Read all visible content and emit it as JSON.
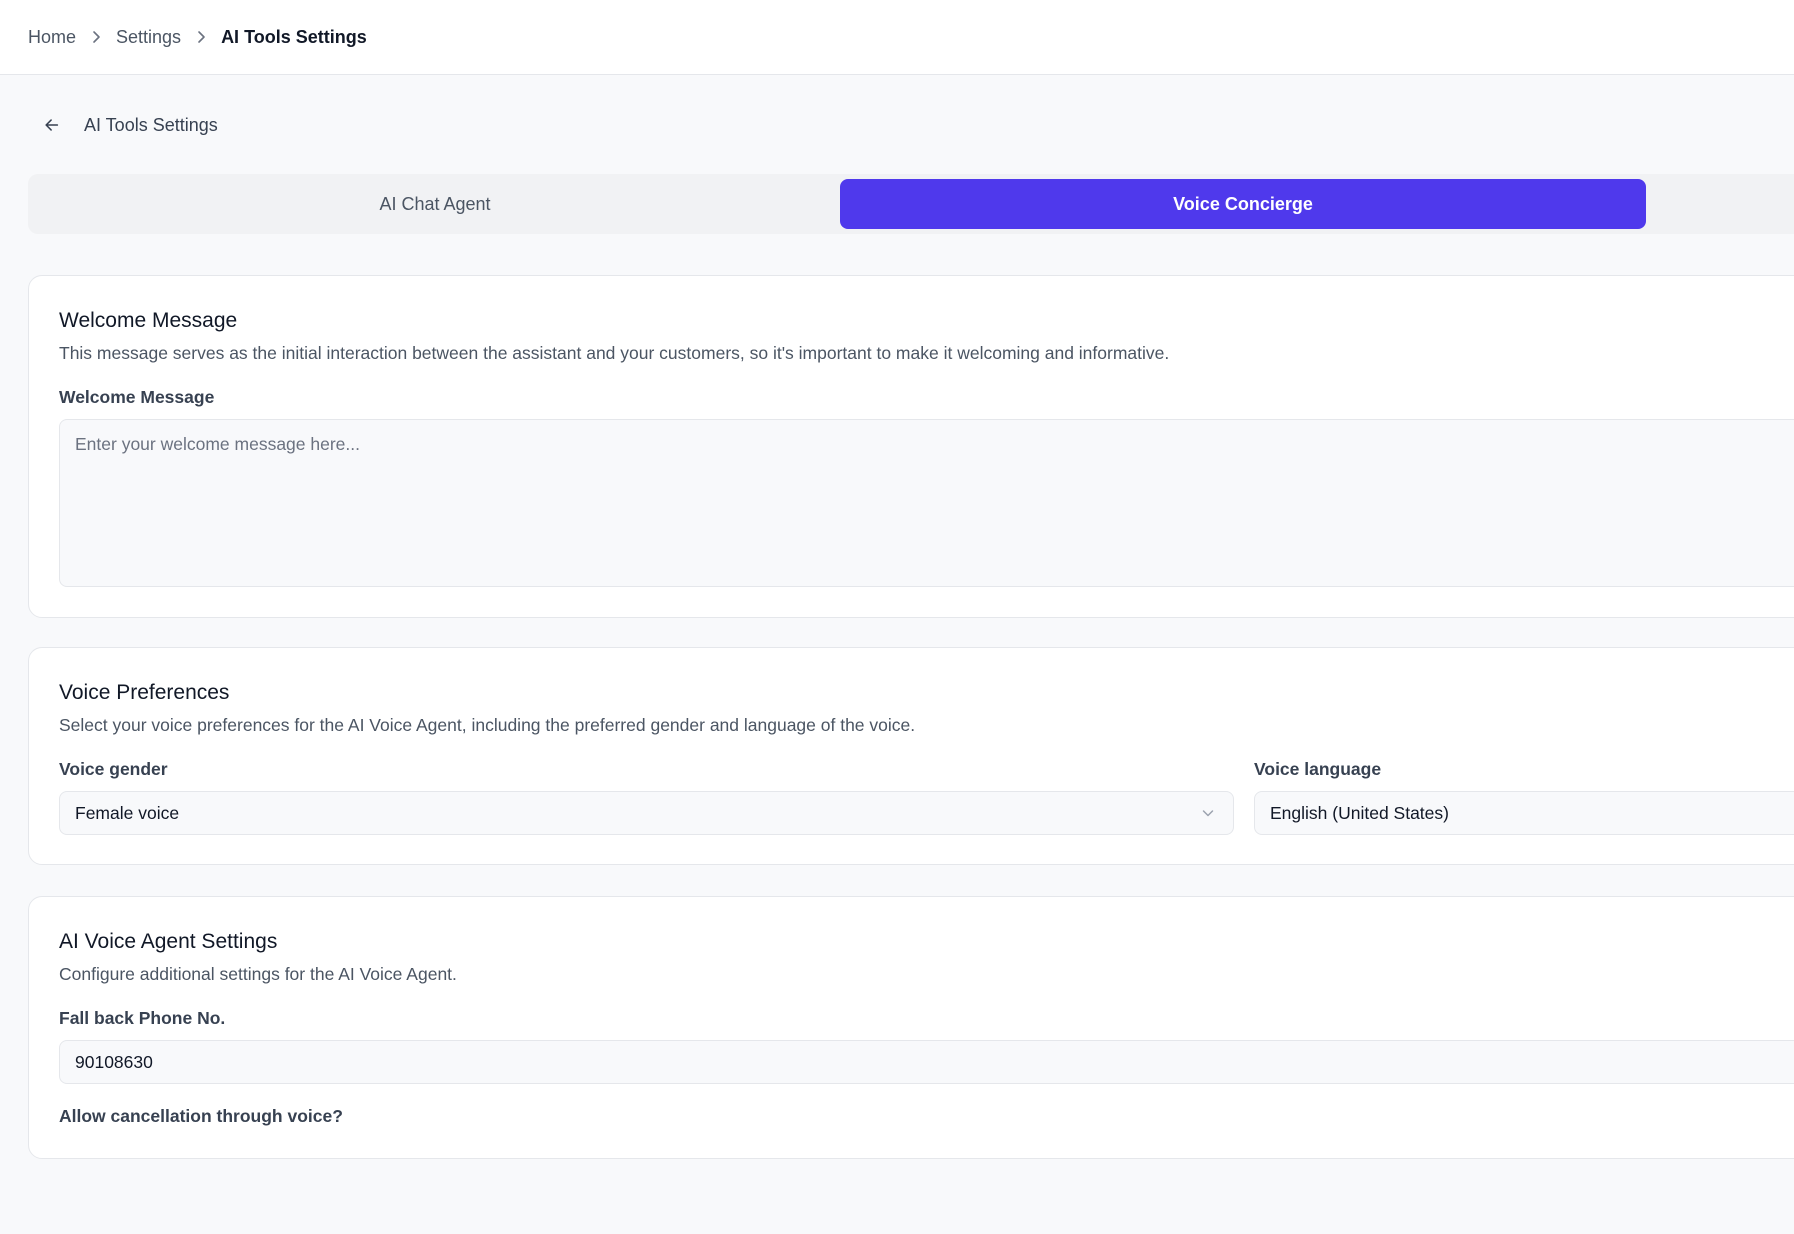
{
  "breadcrumb": {
    "items": [
      "Home",
      "Settings"
    ],
    "current": "AI Tools Settings"
  },
  "page": {
    "title": "AI Tools Settings"
  },
  "tabs": [
    {
      "label": "AI Chat Agent",
      "active": false
    },
    {
      "label": "Voice Concierge",
      "active": true
    }
  ],
  "welcome": {
    "title": "Welcome Message",
    "description": "This message serves as the initial interaction between the assistant and your customers, so it's important to make it welcoming and informative.",
    "label": "Welcome Message",
    "value": "",
    "placeholder": "Enter your welcome message here..."
  },
  "voice_preferences": {
    "title": "Voice Preferences",
    "description": "Select your voice preferences for the AI Voice Agent, including the preferred gender and language of the voice.",
    "gender_label": "Voice gender",
    "gender_value": "Female voice",
    "language_label": "Voice language",
    "language_value": "English (United States)"
  },
  "agent_settings": {
    "title": "AI Voice Agent Settings",
    "description": "Configure additional settings for the AI Voice Agent.",
    "phone_label": "Fall back Phone No.",
    "phone_value": "90108630",
    "cancellation_label": "Allow cancellation through voice?"
  },
  "colors": {
    "accent": "#4f39ec",
    "background": "#f8f9fb",
    "card": "#ffffff",
    "border": "#e5e7eb"
  },
  "icons": {
    "breadcrumb_separator": "chevron-right-icon",
    "back": "arrow-left-icon",
    "select": "chevron-down-icon"
  }
}
